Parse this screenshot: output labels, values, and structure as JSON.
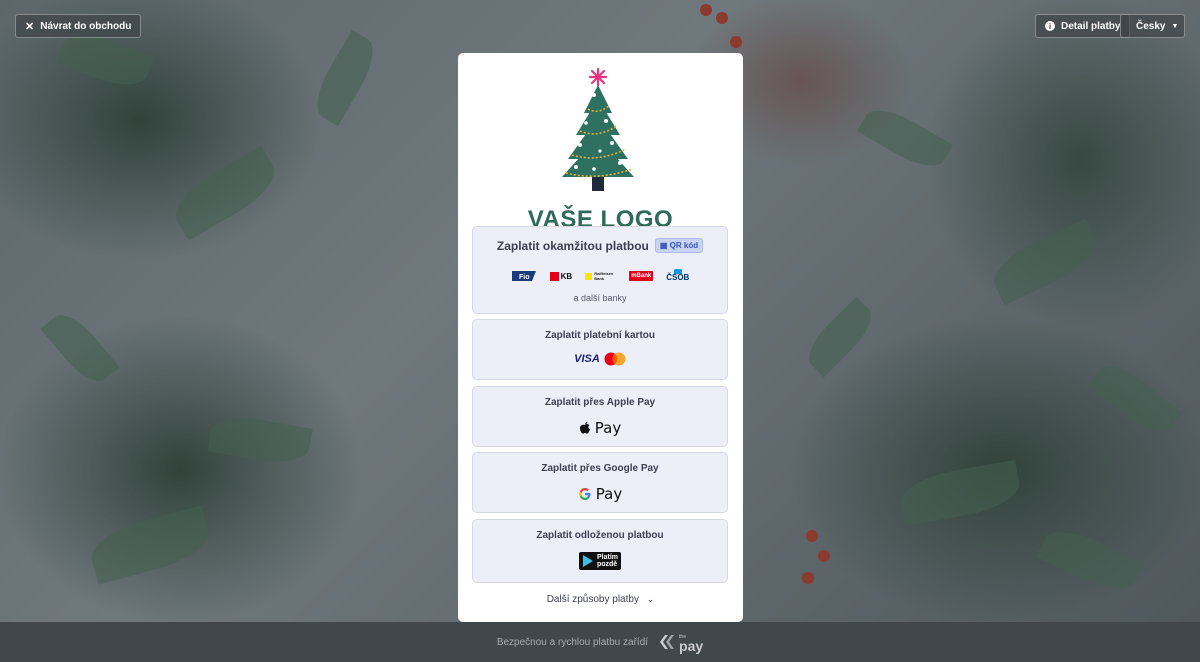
{
  "header": {
    "back_label": "Návrat do obchodu",
    "detail_label": "Detail platby",
    "language_label": "Česky"
  },
  "logo": {
    "text": "VAŠE LOGO"
  },
  "methods": {
    "instant": {
      "title": "Zaplatit okamžitou platbou",
      "qr_badge": "QR kód",
      "banks": [
        "Fio",
        "KB",
        "Raiffeisen Bank",
        "mBank",
        "ČSOB"
      ],
      "more_banks": "a další banky"
    },
    "card": {
      "title": "Zaplatit platební kartou",
      "visa": "VISA"
    },
    "apple": {
      "title": "Zaplatit přes Apple Pay",
      "pay": "Pay"
    },
    "google": {
      "title": "Zaplatit přes Google Pay",
      "pay": "Pay"
    },
    "deferred": {
      "title": "Zaplatit odloženou platbou",
      "brand_line1": "Platím",
      "brand_line2": "pozdě"
    }
  },
  "more_methods": "Další způsoby platby",
  "footer": {
    "text": "Bezpečnou a rychlou platbu zařídí",
    "brand": "pay",
    "brand_small": "the"
  },
  "colors": {
    "accent": "#2f6b5a",
    "method_bg": "#eceef8",
    "footer_bg": "#40474d"
  }
}
